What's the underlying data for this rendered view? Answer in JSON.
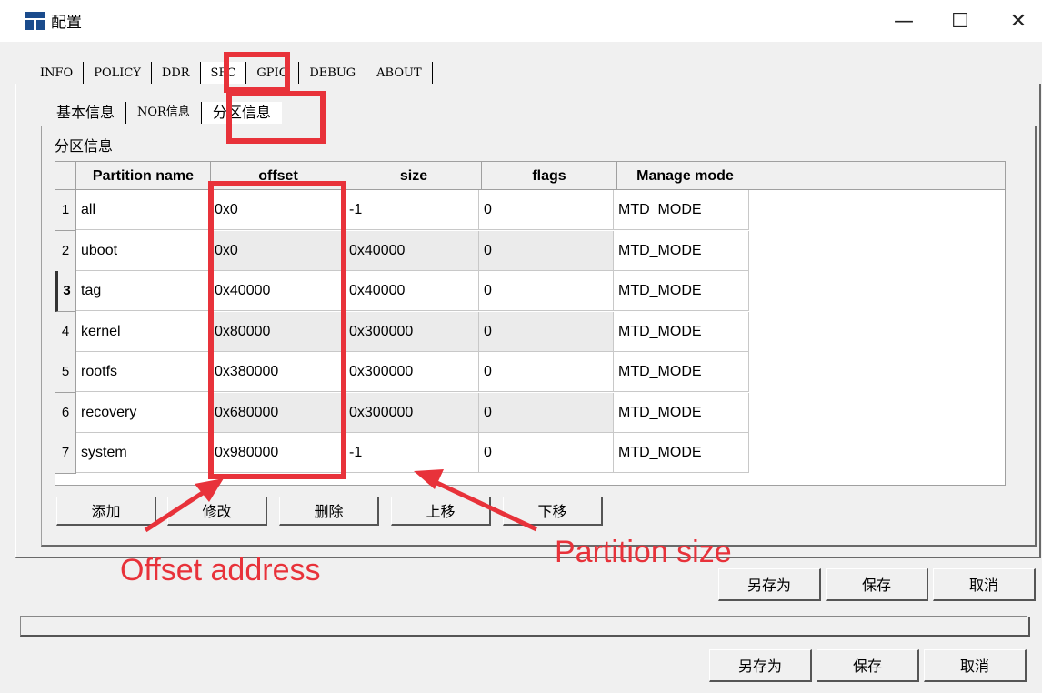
{
  "window": {
    "title": "配置",
    "minimize_label": "—",
    "maximize_label": "☐",
    "close_label": "✕"
  },
  "top_tabs": [
    "INFO",
    "POLICY",
    "DDR",
    "SFC",
    "GPIO",
    "DEBUG",
    "ABOUT"
  ],
  "selected_top_tab": "SFC",
  "sub_tabs": [
    "基本信息",
    "NOR信息",
    "分区信息"
  ],
  "selected_sub_tab": "分区信息",
  "group_label": "分区信息",
  "table": {
    "columns": [
      "Partition name",
      "offset",
      "size",
      "flags",
      "Manage mode"
    ],
    "rows": [
      {
        "num": "1",
        "name": "all",
        "offset": "0x0",
        "size": "-1",
        "flags": "0",
        "mode": "MTD_MODE"
      },
      {
        "num": "2",
        "name": "uboot",
        "offset": "0x0",
        "size": "0x40000",
        "flags": "0",
        "mode": "MTD_MODE"
      },
      {
        "num": "3",
        "name": "tag",
        "offset": "0x40000",
        "size": "0x40000",
        "flags": "0",
        "mode": "MTD_MODE"
      },
      {
        "num": "4",
        "name": "kernel",
        "offset": "0x80000",
        "size": "0x300000",
        "flags": "0",
        "mode": "MTD_MODE"
      },
      {
        "num": "5",
        "name": "rootfs",
        "offset": "0x380000",
        "size": "0x300000",
        "flags": "0",
        "mode": "MTD_MODE"
      },
      {
        "num": "6",
        "name": "recovery",
        "offset": "0x680000",
        "size": "0x300000",
        "flags": "0",
        "mode": "MTD_MODE"
      },
      {
        "num": "7",
        "name": "system",
        "offset": "0x980000",
        "size": "-1",
        "flags": "0",
        "mode": "MTD_MODE"
      }
    ]
  },
  "table_buttons": {
    "add": "添加",
    "modify": "修改",
    "delete": "删除",
    "up": "上移",
    "down": "下移"
  },
  "dialog_buttons": {
    "save_as": "另存为",
    "save": "保存",
    "cancel": "取消"
  },
  "annotations": {
    "offset_label": "Offset address",
    "size_label": "Partition size",
    "color": "#e8323a"
  }
}
